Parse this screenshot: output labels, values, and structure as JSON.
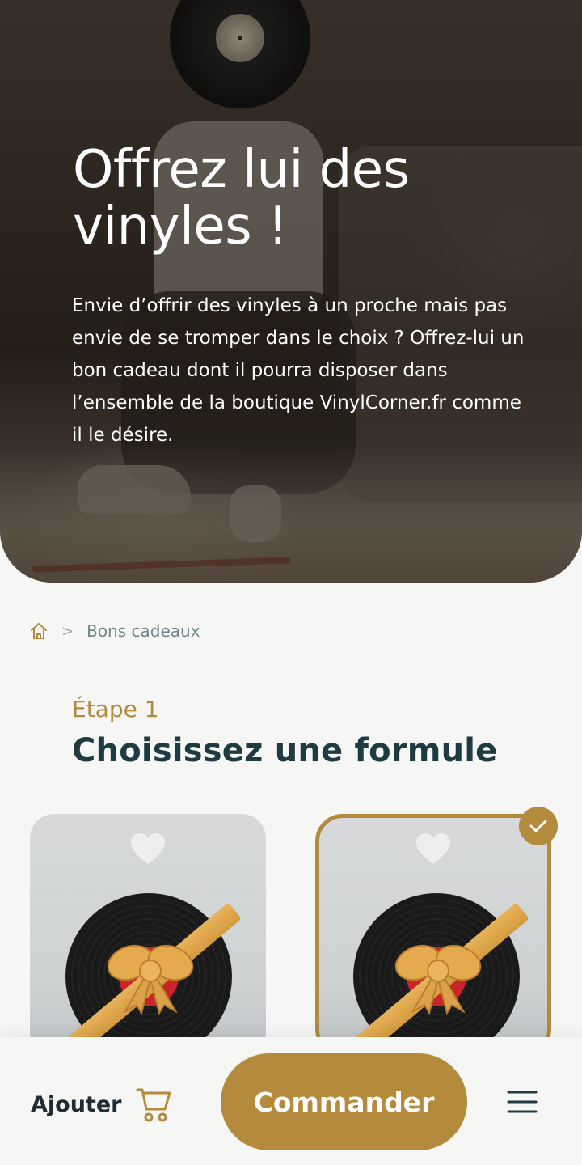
{
  "hero": {
    "title": "Offrez lui des vinyles !",
    "description": "Envie d’offrir des vinyles à un proche mais pas envie de se tromper dans le choix ? Offrez-lui un bon cadeau dont il pourra disposer dans l’ensemble de la boutique VinylCorner.fr comme il le désire."
  },
  "breadcrumb": {
    "home_icon": "home-icon",
    "separator": ">",
    "current": "Bons cadeaux"
  },
  "step": {
    "label": "Étape 1",
    "title": "Choisissez une formule"
  },
  "cards": [
    {
      "icon": "heart-icon",
      "selected": false
    },
    {
      "icon": "heart-icon",
      "selected": true
    }
  ],
  "bottom_bar": {
    "add_label": "Ajouter",
    "cart_icon": "cart-icon",
    "order_label": "Commander",
    "menu_icon": "menu-icon"
  },
  "colors": {
    "accent": "#b48b3c",
    "heading": "#1f3b42",
    "background": "#f6f6f5"
  }
}
